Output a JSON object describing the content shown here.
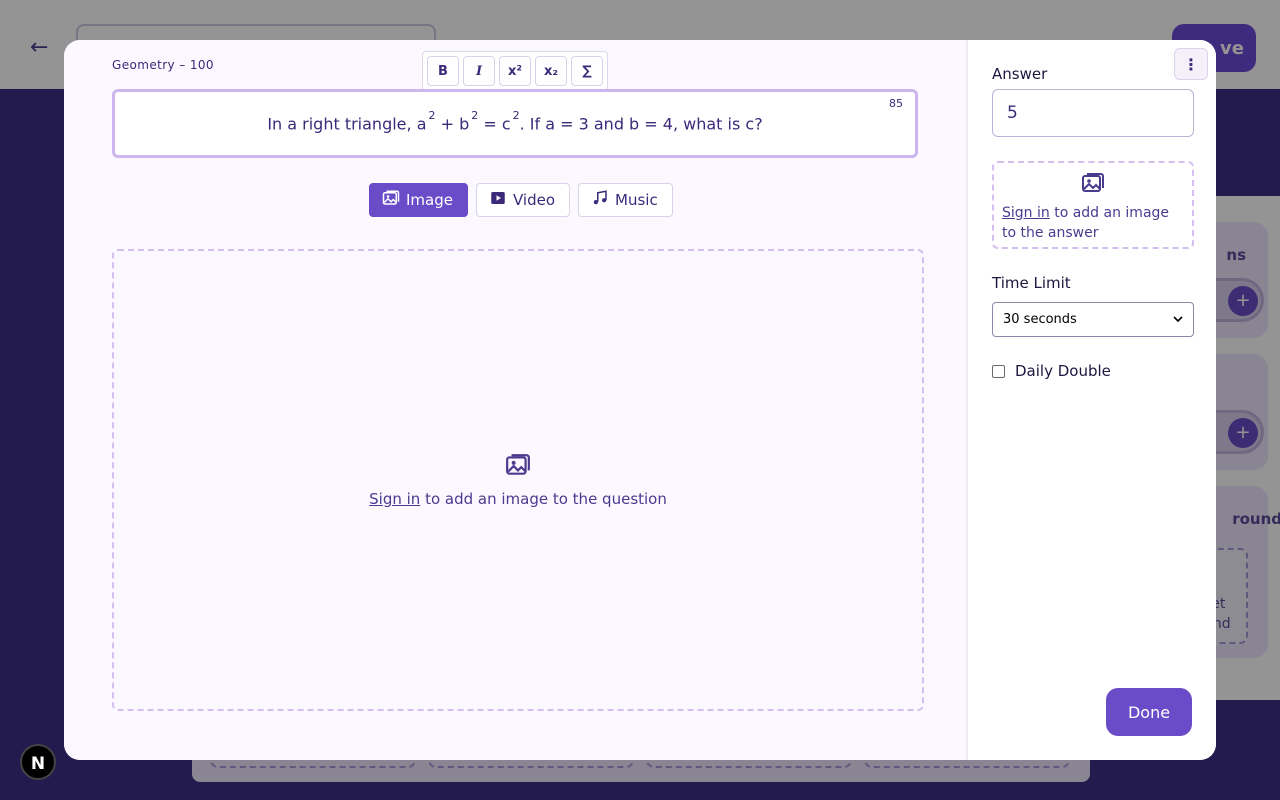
{
  "background": {
    "save_label": "ve",
    "card1_title": "ns",
    "card3_title": "round",
    "card3_text": "set\nund"
  },
  "badge": {
    "letter": "N"
  },
  "modal": {
    "category": "Geometry – 100",
    "toolbar": {
      "bold": "B",
      "italic": "I",
      "superscript": "x²",
      "subscript": "x₂",
      "formula": "∑"
    },
    "question": {
      "text_parts": [
        "In a right triangle, a",
        "2",
        " + b",
        "2",
        " = c",
        "2",
        ". If a = 3 and b = 4, what is c?"
      ],
      "char_count": "85"
    },
    "media_tabs": [
      {
        "label": "Image",
        "icon": "image-icon",
        "active": true
      },
      {
        "label": "Video",
        "icon": "video-icon",
        "active": false
      },
      {
        "label": "Music",
        "icon": "music-icon",
        "active": false
      }
    ],
    "drop": {
      "link": "Sign in",
      "text": " to add an image to the question"
    },
    "answer": {
      "label": "Answer",
      "value": "5",
      "drop_link": "Sign in",
      "drop_text": " to add an image to the answer"
    },
    "time": {
      "label": "Time Limit",
      "selected": "30 seconds"
    },
    "daily_double": {
      "label": "Daily Double",
      "checked": false
    },
    "done_label": "Done",
    "more_icon": "more-vertical-icon"
  },
  "colors": {
    "accent": "#6a4cc9",
    "text": "#3b2a7a",
    "border_dashed": "#d4bff0"
  }
}
